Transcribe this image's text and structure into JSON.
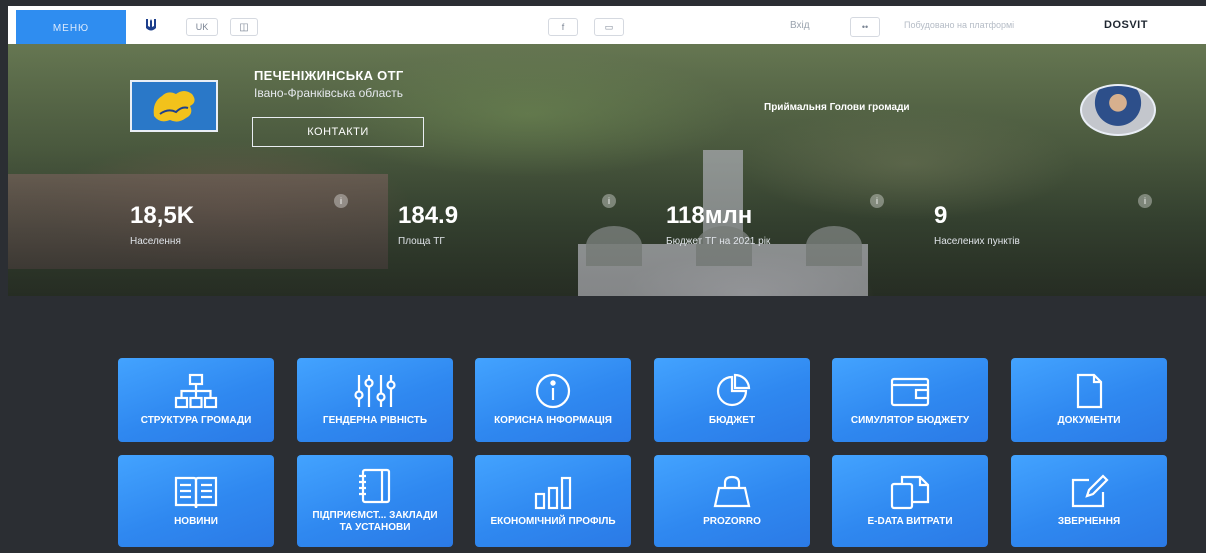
{
  "topbar": {
    "menu_label": "МЕНЮ",
    "lang": "UK",
    "accessibility": "◫",
    "social1": "f",
    "social2": "▭",
    "login_label": "Вхід",
    "login_button": "••",
    "platform_text": "Побудовано на платформі",
    "brand": "DOSVIT"
  },
  "org": {
    "title": "ПЕЧЕНІЖИНСЬКА ОТГ",
    "region": "Івано-Франківська область",
    "contacts_label": "КОНТАКТИ",
    "reception_label": "Приймальня Голови громади"
  },
  "stats": [
    {
      "value": "18,5K",
      "label": "Населення"
    },
    {
      "value": "184.9",
      "label": "Площа ТГ"
    },
    {
      "value": "118млн",
      "label": "Бюджет ТГ на 2021 рік"
    },
    {
      "value": "9",
      "label": "Населених пунктів"
    }
  ],
  "tiles": [
    {
      "label": "СТРУКТУРА ГРОМАДИ",
      "icon": "structure-icon"
    },
    {
      "label": "ГЕНДЕРНА РІВНІСТЬ",
      "icon": "sliders-icon"
    },
    {
      "label": "КОРИСНА ІНФОРМАЦІЯ",
      "icon": "info-icon"
    },
    {
      "label": "БЮДЖЕТ",
      "icon": "pie-icon"
    },
    {
      "label": "СИМУЛЯТОР БЮДЖЕТУ",
      "icon": "wallet-icon"
    },
    {
      "label": "ДОКУМЕНТИ",
      "icon": "document-icon"
    },
    {
      "label": "НОВИНИ",
      "icon": "book-icon"
    },
    {
      "label": "ПІДПРИЄМСТ... ЗАКЛАДИ ТА УСТАНОВИ",
      "icon": "notebook-icon"
    },
    {
      "label": "ЕКОНОМІЧНИЙ ПРОФІЛЬ",
      "icon": "bar-chart-icon"
    },
    {
      "label": "PROZORRO",
      "icon": "bag-icon"
    },
    {
      "label": "E-DATA ВИТРАТИ",
      "icon": "copy-icon"
    },
    {
      "label": "ЗВЕРНЕННЯ",
      "icon": "edit-icon"
    }
  ],
  "colors": {
    "tile": "#2f88f0",
    "background": "#2b2e33",
    "menu": "#2f8df0"
  }
}
